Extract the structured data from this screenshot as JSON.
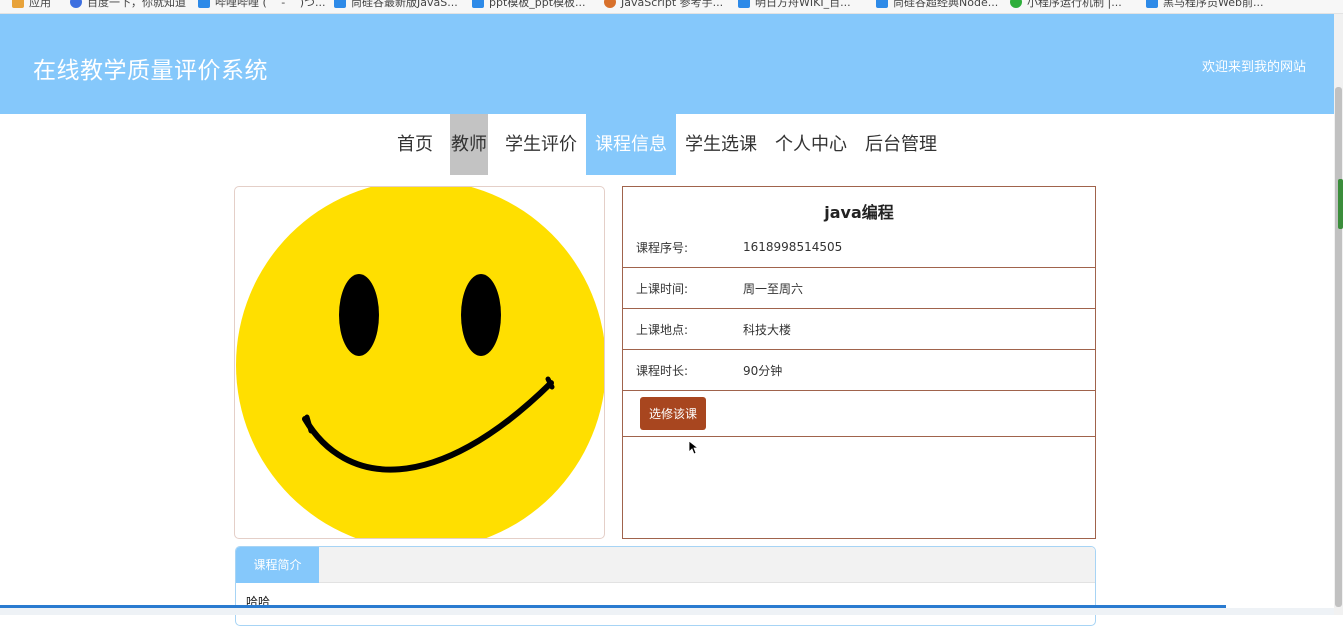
{
  "bookmarks": [
    {
      "label": "应用",
      "color": "#e8a33b"
    },
    {
      "label": "百度一下，你就知道",
      "color": "#3d6fe0"
    },
    {
      "label": "哔哩哔哩 ( ゜- ゜)つ...",
      "color": "#2d8ae8"
    },
    {
      "label": "尚硅谷最新版JavaS...",
      "color": "#2d8ae8"
    },
    {
      "label": "ppt模板_ppt模板...",
      "color": "#2d8ae8"
    },
    {
      "label": "JavaScript 参考手...",
      "color": "#d8712c"
    },
    {
      "label": "明日方舟WIKI_百...",
      "color": "#2d8ae8"
    },
    {
      "label": "尚硅谷超经典Node...",
      "color": "#2d8ae8"
    },
    {
      "label": "小程序运行机制 |...",
      "color": "#2eae3b"
    },
    {
      "label": "黑马程序员Web前...",
      "color": "#2d8ae8"
    }
  ],
  "header": {
    "title": "在线教学质量评价系统",
    "welcome": "欢迎来到我的网站"
  },
  "nav": {
    "items": [
      {
        "label": "首页",
        "state": "normal"
      },
      {
        "label": "教师",
        "state": "hover"
      },
      {
        "label": "学生评价",
        "state": "normal"
      },
      {
        "label": "课程信息",
        "state": "active"
      },
      {
        "label": "学生选课",
        "state": "normal"
      },
      {
        "label": "个人中心",
        "state": "normal"
      },
      {
        "label": "后台管理",
        "state": "normal"
      }
    ]
  },
  "course": {
    "name": "java编程",
    "rows": [
      {
        "label": "课程序号:",
        "value": "1618998514505"
      },
      {
        "label": "上课时间:",
        "value": "周一至周六"
      },
      {
        "label": "上课地点:",
        "value": "科技大楼"
      },
      {
        "label": "课程时长:",
        "value": "90分钟"
      }
    ],
    "select_button": "选修该课",
    "image_icon": "smiley-face-icon"
  },
  "tabs": {
    "active_tab": "课程简介",
    "content": "哈哈"
  },
  "colors": {
    "header_bg": "#85c8fb",
    "nav_active_bg": "#85c8fb",
    "nav_hover_bg": "#c3c3c3",
    "button_bg": "#a8461f",
    "panel_border": "#a0634c"
  }
}
